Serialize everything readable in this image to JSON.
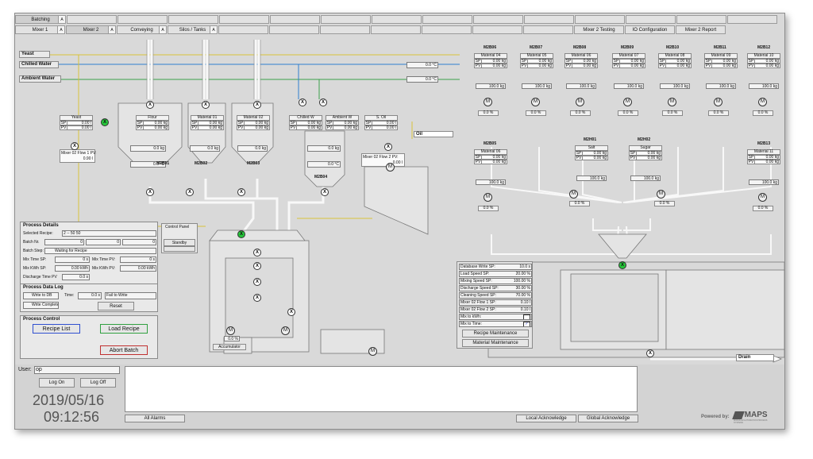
{
  "nav_top": {
    "batching": "Batching",
    "flag": "A"
  },
  "nav_tabs": [
    {
      "label": "Mixer 1",
      "flag": "A"
    },
    {
      "label": "Mixer 2",
      "flag": "A"
    },
    {
      "label": "Conveying",
      "flag": "A"
    },
    {
      "label": "Silos / Tanks",
      "flag": "A"
    }
  ],
  "nav_right_tabs": [
    {
      "label": "Mixer 2 Testing"
    },
    {
      "label": "IO Configuration"
    },
    {
      "label": "Mixer 2 Report"
    }
  ],
  "lines": {
    "yeast": "Yeast",
    "chilled": "Chilled Water",
    "chilled_temp": "0.0 °C",
    "ambient": "Ambient Water",
    "ambient_temp": "0.0 °C",
    "oil": "Oil"
  },
  "left_tanks": [
    {
      "name": "Yeast",
      "sp": "0.00 l",
      "pv": "0.00 l",
      "tag": "M2B01",
      "flow_label": "Mixer 02 Flow 1 PV:",
      "flow_value": "0.90 l"
    },
    {
      "name": "Flour",
      "sp": "0.00 kg",
      "pv": "0.00 kg",
      "weight": "0.0 kg",
      "temp": "0.0 °C"
    },
    {
      "name": "Material 01",
      "sp": "0.00 kg",
      "pv": "0.00 kg",
      "weight": "0.0 kg",
      "tag": "M2B02"
    },
    {
      "name": "Material 02",
      "sp": "0.00 kg",
      "pv": "0.00 kg",
      "weight": "0.0 kg",
      "tag": "M2B03"
    },
    {
      "name": "Chilled W",
      "sp": "0.00 kg",
      "pv": "0.00 kg"
    },
    {
      "name": "Ambient W",
      "sp": "0.00 kg",
      "pv": "0.00 kg",
      "weight": "0.0 kg",
      "temp": "0.0 °C",
      "tag": "M2B04"
    },
    {
      "name": "S. Oil",
      "sp": "0.00 l",
      "pv": "0.00 l",
      "flow_label": "Mixer 02 Flow 2 PV:",
      "flow_value": "0.00 l"
    }
  ],
  "right_bins_top": [
    {
      "tag": "M2B06",
      "name": "Material 04",
      "sp": "0.00 kg",
      "pv": "0.00 kg",
      "weight": "100.0 kg",
      "pct": "0.0 %"
    },
    {
      "tag": "M2B07",
      "name": "Material 05",
      "sp": "0.00 kg",
      "pv": "0.00 kg",
      "weight": "100.0 kg",
      "pct": "0.0 %"
    },
    {
      "tag": "M2B08",
      "name": "Material 06",
      "sp": "0.00 kg",
      "pv": "0.00 kg",
      "weight": "100.0 kg",
      "pct": "0.0 %"
    },
    {
      "tag": "M2B09",
      "name": "Material 07",
      "sp": "0.00 kg",
      "pv": "0.00 kg",
      "weight": "100.0 kg",
      "pct": "0.0 %"
    },
    {
      "tag": "M2B10",
      "name": "Material 08",
      "sp": "0.00 kg",
      "pv": "0.00 kg",
      "weight": "100.0 kg",
      "pct": "0.0 %"
    },
    {
      "tag": "M2B11",
      "name": "Material 09",
      "sp": "0.00 kg",
      "pv": "0.00 kg",
      "weight": "100.0 kg",
      "pct": "0.0 %"
    },
    {
      "tag": "M2B12",
      "name": "Material 10",
      "sp": "0.00 kg",
      "pv": "0.00 kg",
      "weight": "100.0 kg",
      "pct": "0.0 %"
    }
  ],
  "right_bins_mid": [
    {
      "tag": "M2B05",
      "name": "Material 06",
      "sp": "0.00 kg",
      "pv": "0.00 kg",
      "weight": "100.0 kg",
      "pct": "0.0 %"
    },
    {
      "tag": "M2H01",
      "name": "Salt",
      "sp": "0.00 kg",
      "pv": "0.00 kg",
      "weight": "100.0 kg",
      "pct": "0.0 %"
    },
    {
      "tag": "M2H02",
      "name": "Sugar",
      "sp": "0.00 kg",
      "pv": "0.00 kg",
      "weight": "100.0 kg",
      "pct": "0.0 %"
    },
    {
      "tag": "M2B13",
      "name": "Material 11",
      "sp": "0.00 kg",
      "pv": "0.00 kg",
      "weight": "100.0 kg",
      "pct": "0.0 %"
    }
  ],
  "labels": {
    "sp": "SP",
    "pv": "PV",
    "e": "E",
    "a": "A",
    "m": "M",
    "x": "X",
    "c": "C",
    "e_small": "E"
  },
  "process_details": {
    "title": "Process Details",
    "selected_recipe_label": "Selected Recipe:",
    "selected_recipe": "2 -- 50 50",
    "batch_nr_label": "Batch Nr.",
    "batch_nr_a": "0",
    "batch_nr_b": "0",
    "batch_nr_c": "0",
    "batch_step_label": "Batch Step:",
    "batch_step": "Waiting for Recipe",
    "mix_time_sp_label": "Mix Time SP:",
    "mix_time_sp": "0 s",
    "mix_time_pv_label": "Mix Time PV:",
    "mix_time_pv": "0 s",
    "mix_kwh_sp_label": "Mix KWh SP:",
    "mix_kwh_sp": "0.00 kWh",
    "mix_kwh_pv_label": "Mix KWh PV:",
    "mix_kwh_pv": "0.00 kWh",
    "discharge_label": "Discharge Time PV",
    "discharge": "0.0 s"
  },
  "control_panel": {
    "title": "Control Panel",
    "standby": "Standby"
  },
  "data_log": {
    "title": "Process Data Log",
    "write_db": "Write to DB",
    "time_label": "Time:",
    "time": "0.0 s",
    "fail_write": "Fail to Write",
    "write_complete": "Write Complete",
    "reset": "Reset"
  },
  "process_control": {
    "title": "Process Control",
    "recipe_list": "Recipe List",
    "load_recipe": "Load Recipe",
    "abort_batch": "Abort Batch"
  },
  "mixer": {
    "accumulator": "Accumulator",
    "pct": "0.0 %"
  },
  "setpoints": [
    {
      "label": "Database Write SP:",
      "value": "10.0 s"
    },
    {
      "label": "Load Speed SP:",
      "value": "20.00 %"
    },
    {
      "label": "Mixing Speed SP:",
      "value": "100.00 %"
    },
    {
      "label": "Discharge Speed SP:",
      "value": "30.00 %"
    },
    {
      "label": "Cleaning Speed SP:",
      "value": "70.00 %"
    },
    {
      "label": "Mixer 02 Flow 1 SP:",
      "value": "0.10 l"
    },
    {
      "label": "Mixer 02 Flow 2 SP:",
      "value": "0.10 l"
    },
    {
      "label": "Mix to kWh:",
      "value": ""
    },
    {
      "label": "Mix to Time:",
      "value": "✓"
    }
  ],
  "maint": {
    "recipe": "Recipe Maintenance",
    "material": "Material Maintenance"
  },
  "drain": "Drain",
  "bottom": {
    "user_label": "User:",
    "user": "op",
    "logon": "Log On",
    "logoff": "Log Off",
    "date": "2019/05/16",
    "time": "09:12:56",
    "all_alarms": "All Alarms",
    "local_ack": "Local Acknowledge",
    "global_ack": "Global Acknowledge",
    "powered": "Powered by:",
    "brand": "MAPS",
    "brand_sub": "MODULAR AUTOMATION PROCESS SYSTEMS"
  },
  "colors": {
    "yeast_line": "#d9c23a",
    "chilled_line": "#2f7fd0",
    "ambient_line": "#3aa14a",
    "valve_green": "#26c53a"
  }
}
